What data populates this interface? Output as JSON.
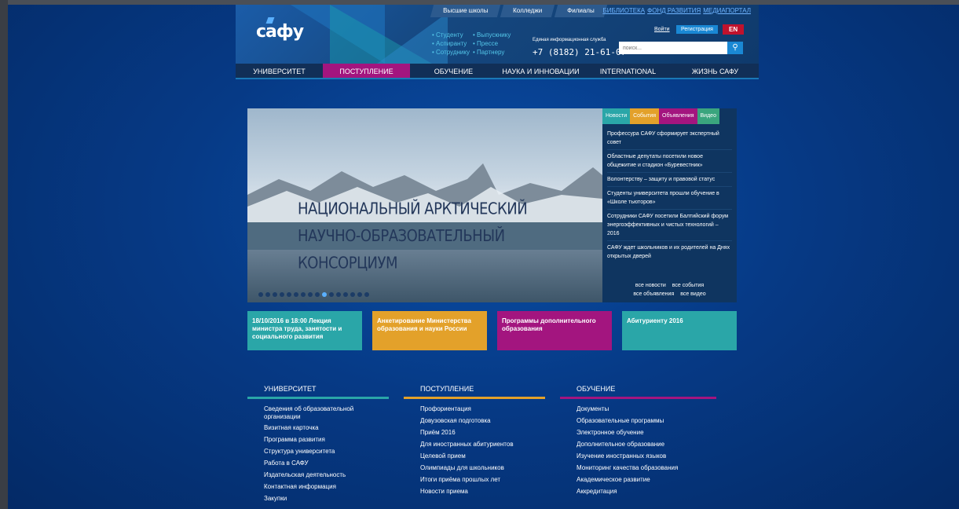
{
  "header": {
    "logo_text": "caфy",
    "top_tabs": [
      "Высшие школы",
      "Колледжи",
      "Филиалы"
    ],
    "top_links": [
      "БИБЛИОТЕКА",
      "ФОНД РАЗВИТИЯ",
      "МЕДИАПОРТАЛ"
    ],
    "quick_links": [
      "• Студенту",
      "• Выпускнику",
      "• Аспиранту",
      "• Прессе",
      "• Сотруднику",
      "• Партнеру"
    ],
    "hotline_label": "Единая информационная служба",
    "hotline_phone": "+7 (8182) 21-61-07",
    "login_label": "Войти",
    "register_label": "Регистрация",
    "lang_label": "EN",
    "search_placeholder": "поиск..."
  },
  "nav": {
    "items": [
      "УНИВЕРСИТЕТ",
      "ПОСТУПЛЕНИЕ",
      "ОБУЧЕНИЕ",
      "НАУКА И ИННОВАЦИИ",
      "INTERNATIONAL",
      "ЖИЗНЬ САФУ"
    ],
    "active": "ПОСТУПЛЕНИЕ"
  },
  "slider": {
    "title_line1": "НАЦИОНАЛЬНЫЙ АРКТИЧЕСКИЙ",
    "title_line2": "НАУЧНО-ОБРАЗОВАТЕЛЬНЫЙ КОНСОРЦИУМ",
    "dot_count": 16,
    "active_dot": 9
  },
  "news": {
    "tabs": [
      {
        "label": "Новости",
        "color": "#2aa6a8"
      },
      {
        "label": "События",
        "color": "#e3a12a"
      },
      {
        "label": "Объявления",
        "color": "#a3157f"
      },
      {
        "label": "Видео",
        "color": "#3aa57e"
      }
    ],
    "items": [
      "Профессура САФУ сформирует экспертный совет",
      "Областные депутаты посетили новое общежитие и стадион «Буревестник»",
      "Волонтерству – защиту и правовой статус",
      "Студенты университета прошли обучение в «Школе тьюторов»",
      "Сотрудники САФУ посетили Балтийский форум энергоэффективных и чистых технологий – 2016",
      "САФУ ждет школьников и их родителей на Днях открытых дверей"
    ],
    "footer_row1": [
      "все новости",
      "все события"
    ],
    "footer_row2": [
      "все объявления",
      "все видео"
    ]
  },
  "tiles": [
    {
      "text": "18/10/2016 в 18:00 Лекция министра труда, занятости и социального развития",
      "color": "#2aa6a8"
    },
    {
      "text": "Анкетирование Министерства образования и науки России",
      "color": "#e3a12a"
    },
    {
      "text": "Программы дополнительного образования",
      "color": "#a3157f"
    },
    {
      "text": "Абитуриенту 2016",
      "color": "#2aa6a8"
    }
  ],
  "footer": {
    "columns": [
      {
        "title": "УНИВЕРСИТЕТ",
        "color": "#2aa6a8",
        "items": [
          "Сведения об образовательной организации",
          "Визитная карточка",
          "Программа развития",
          "Структура университета",
          "Работа в САФУ",
          "Издательская деятельность",
          "Контактная информация",
          "Закупки"
        ]
      },
      {
        "title": "ПОСТУПЛЕНИЕ",
        "color": "#e3a12a",
        "items": [
          "Профориентация",
          "Довузовская подготовка",
          "Приём 2016",
          "Для иностранных абитуриентов",
          "Целевой прием",
          "Олимпиады для школьников",
          "Итоги приёма прошлых лет",
          "Новости приема"
        ]
      },
      {
        "title": "ОБУЧЕНИЕ",
        "color": "#a3157f",
        "items": [
          "Документы",
          "Образовательные программы",
          "Электронное обучение",
          "Дополнительное образование",
          "Изучение иностранных языков",
          "Мониторинг качества образования",
          "Академическое развитие",
          "Аккредитация"
        ]
      }
    ]
  }
}
